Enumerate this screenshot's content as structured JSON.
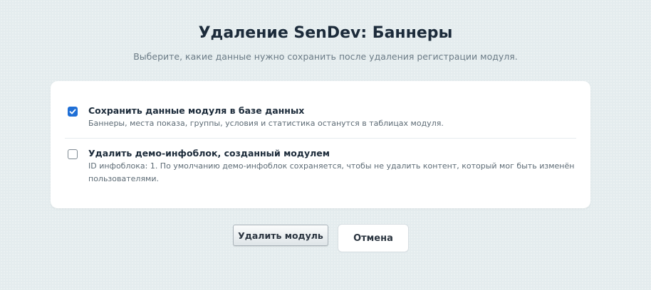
{
  "page": {
    "title": "Удаление SenDev: Баннеры",
    "subtitle": "Выберите, какие данные нужно сохранить после удаления регистрации модуля."
  },
  "options": [
    {
      "checked": true,
      "label": "Сохранить данные модуля в базе данных",
      "description": "Баннеры, места показа, группы, условия и статистика останутся в таблицах модуля."
    },
    {
      "checked": false,
      "label": "Удалить демо-инфоблок, созданный модулем",
      "description": "ID инфоблока: 1. По умолчанию демо-инфоблок сохраняется, чтобы не удалить контент, который мог быть изменён пользователями."
    }
  ],
  "buttons": {
    "delete_label": "Удалить модуль",
    "cancel_label": "Отмена"
  },
  "colors": {
    "accent": "#1f6fd6",
    "background": "#e4ecee"
  }
}
